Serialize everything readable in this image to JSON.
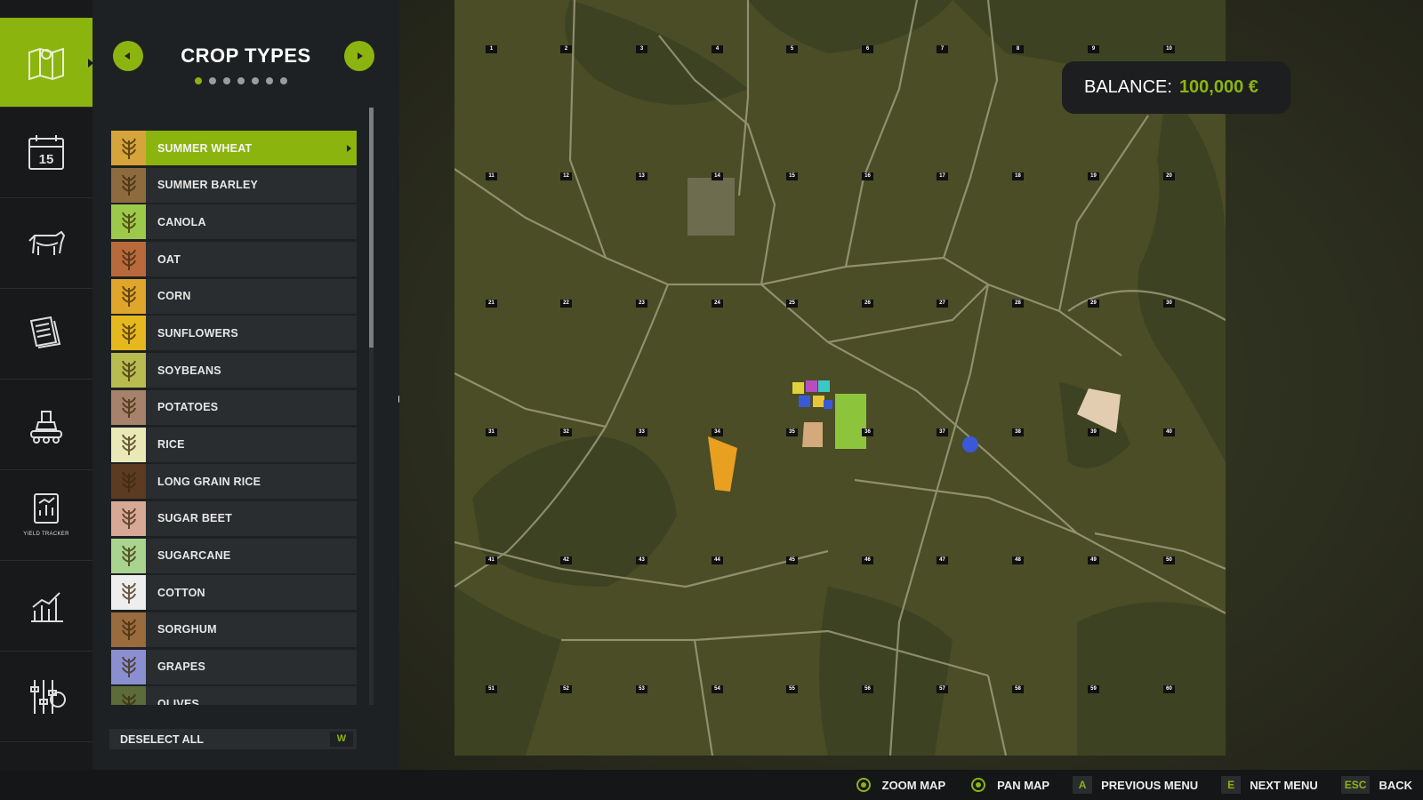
{
  "rail": {
    "items": [
      {
        "name": "map-icon",
        "active": true
      },
      {
        "name": "calendar-icon",
        "text": "15"
      },
      {
        "name": "animals-icon"
      },
      {
        "name": "contracts-icon"
      },
      {
        "name": "production-icon"
      },
      {
        "name": "yield-tracker-icon",
        "caption": "YIELD TRACKER"
      },
      {
        "name": "statistics-icon"
      },
      {
        "name": "settings-icon"
      }
    ]
  },
  "panel": {
    "title": "CROP TYPES",
    "page_count": 7,
    "current_page": 1
  },
  "crops": [
    {
      "label": "SUMMER WHEAT",
      "icon": "wheat-icon",
      "color": "#d5a43a",
      "selected": true
    },
    {
      "label": "SUMMER BARLEY",
      "icon": "barley-icon",
      "color": "#8e6b3f"
    },
    {
      "label": "CANOLA",
      "icon": "canola-icon",
      "color": "#9cc94a"
    },
    {
      "label": "OAT",
      "icon": "oat-icon",
      "color": "#b86a3c"
    },
    {
      "label": "CORN",
      "icon": "corn-icon",
      "color": "#e0a52b"
    },
    {
      "label": "SUNFLOWERS",
      "icon": "sunflower-icon",
      "color": "#e5b81d"
    },
    {
      "label": "SOYBEANS",
      "icon": "soybean-icon",
      "color": "#b8bb4f"
    },
    {
      "label": "POTATOES",
      "icon": "potato-icon",
      "color": "#a6826c"
    },
    {
      "label": "RICE",
      "icon": "rice-icon",
      "color": "#e9e9b8"
    },
    {
      "label": "LONG GRAIN RICE",
      "icon": "long-grain-rice-icon",
      "color": "#5d3a22"
    },
    {
      "label": "SUGAR BEET",
      "icon": "sugar-beet-icon",
      "color": "#d8a896"
    },
    {
      "label": "SUGARCANE",
      "icon": "sugarcane-icon",
      "color": "#a8d48f"
    },
    {
      "label": "COTTON",
      "icon": "cotton-icon",
      "color": "#eeeeee"
    },
    {
      "label": "SORGHUM",
      "icon": "sorghum-icon",
      "color": "#9a6b3d"
    },
    {
      "label": "GRAPES",
      "icon": "grapes-icon",
      "color": "#8a8fd0"
    },
    {
      "label": "OLIVES",
      "icon": "olives-icon",
      "color": "#5b6b3a"
    }
  ],
  "deselect": {
    "label": "DESELECT ALL",
    "key": "W"
  },
  "balance": {
    "label": "BALANCE:",
    "value": "100,000 €"
  },
  "map": {
    "grid_labels": [
      "1",
      "2",
      "3",
      "4",
      "5",
      "6",
      "7",
      "8",
      "9",
      "10",
      "11",
      "12",
      "13",
      "14",
      "15",
      "16",
      "17",
      "18",
      "19",
      "20",
      "21",
      "22",
      "23",
      "24",
      "25",
      "26",
      "27",
      "28",
      "29",
      "30",
      "31",
      "32",
      "33",
      "34",
      "35",
      "36",
      "37",
      "38",
      "39",
      "40",
      "41",
      "42",
      "43",
      "44",
      "45",
      "46",
      "47",
      "48",
      "49",
      "50",
      "51",
      "52",
      "53",
      "54",
      "55",
      "56",
      "57",
      "58",
      "59",
      "60"
    ]
  },
  "bottom_bar": {
    "hints": [
      {
        "key": "",
        "glyph": "stick-icon",
        "label": "ZOOM MAP"
      },
      {
        "key": "",
        "glyph": "stick-icon",
        "label": "PAN MAP"
      },
      {
        "key": "A",
        "label": "PREVIOUS MENU"
      },
      {
        "key": "E",
        "label": "NEXT MENU"
      },
      {
        "key": "ESC",
        "label": "BACK"
      }
    ]
  },
  "colors": {
    "accent": "#8cb40f",
    "panel": "#1e2123",
    "row": "#2a2d30",
    "map": "#4a4d26"
  }
}
